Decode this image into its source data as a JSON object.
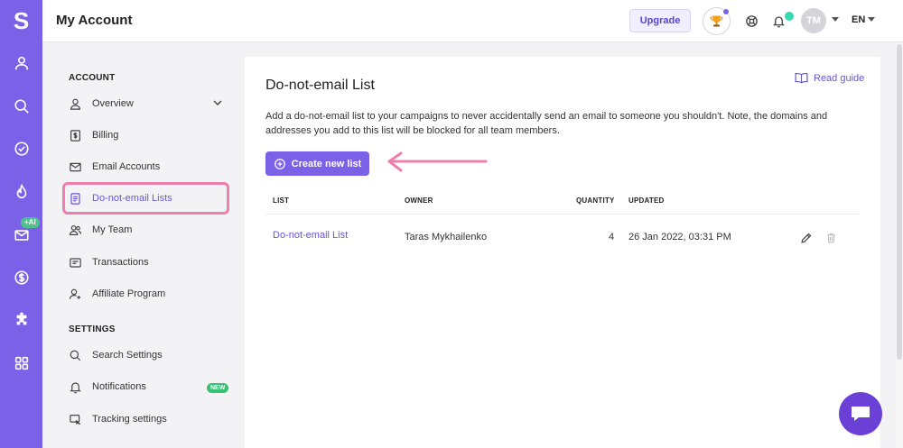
{
  "rail": {
    "logo": "S",
    "ai_badge": "+AI",
    "items": [
      "person-icon",
      "search-icon",
      "check-circle-icon",
      "flame-icon",
      "mail-icon",
      "dollar-icon",
      "puzzle-icon",
      "grid-icon"
    ]
  },
  "header": {
    "title": "My Account",
    "upgrade_label": "Upgrade",
    "avatar_initials": "TM",
    "language": "EN"
  },
  "sidebar": {
    "account_section": "ACCOUNT",
    "settings_section": "SETTINGS",
    "items": [
      {
        "label": "Overview",
        "icon": "user-icon"
      },
      {
        "label": "Billing",
        "icon": "dollar-doc-icon"
      },
      {
        "label": "Email Accounts",
        "icon": "mail-icon"
      },
      {
        "label": "Do-not-email Lists",
        "icon": "doc-list-icon",
        "active": true
      },
      {
        "label": "My Team",
        "icon": "team-icon"
      },
      {
        "label": "Transactions",
        "icon": "card-icon"
      },
      {
        "label": "Affiliate Program",
        "icon": "user-plus-icon"
      }
    ],
    "settings_items": [
      {
        "label": "Search Settings",
        "icon": "search-icon"
      },
      {
        "label": "Notifications",
        "icon": "bell-icon",
        "badge": "NEW"
      },
      {
        "label": "Tracking settings",
        "icon": "tracking-icon"
      }
    ]
  },
  "main": {
    "title": "Do-not-email List",
    "read_guide": "Read guide",
    "description": "Add a do-not-email list to your campaigns to never accidentally send an email to someone you shouldn't. Note, the domains and addresses you add to this list will be blocked for all team members.",
    "create_button": "Create new list",
    "table": {
      "headers": {
        "list": "LIST",
        "owner": "OWNER",
        "quantity": "QUANTITY",
        "updated": "UPDATED"
      },
      "rows": [
        {
          "list": "Do-not-email List",
          "owner": "Taras Mykhailenko",
          "quantity": "4",
          "updated": "26 Jan 2022, 03:31 PM"
        }
      ]
    }
  },
  "colors": {
    "accent": "#7b61e8",
    "highlight": "#ee7fac",
    "new_badge": "#38c172"
  }
}
